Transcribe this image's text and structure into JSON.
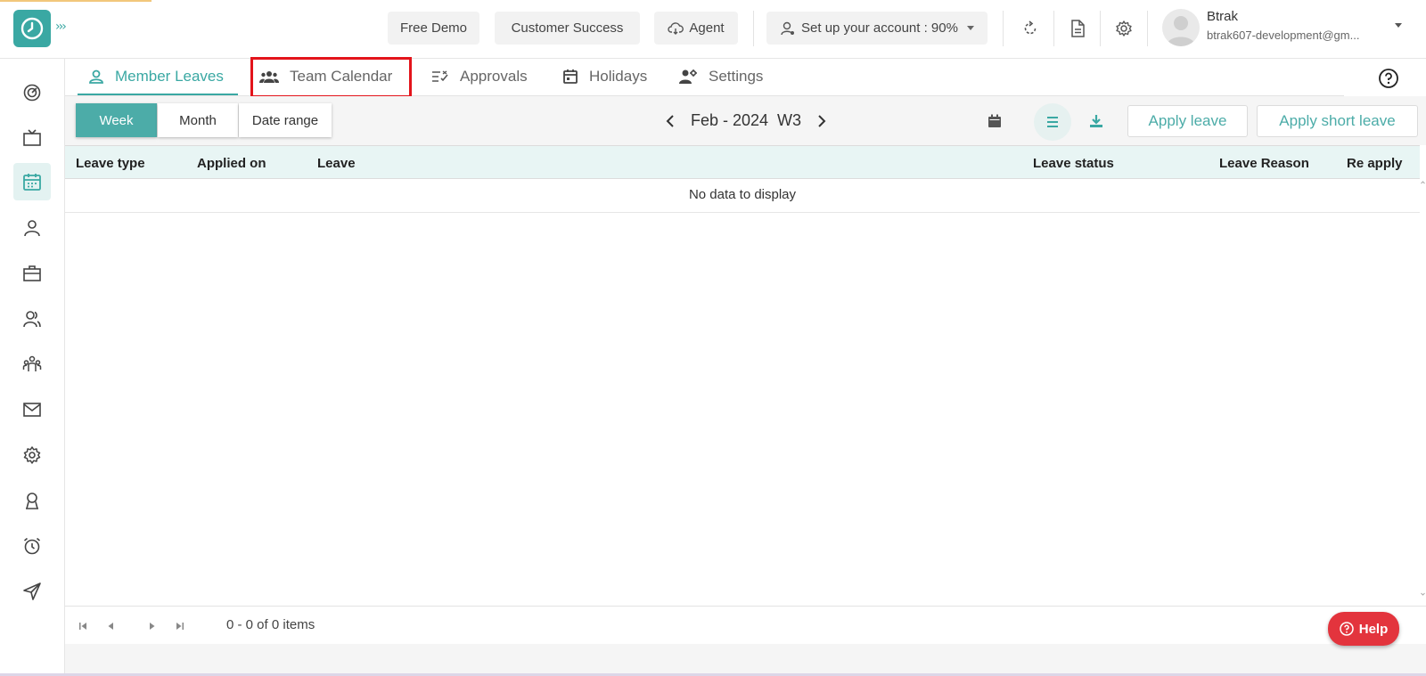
{
  "header": {
    "buttons": {
      "free_demo": "Free Demo",
      "customer_success": "Customer Success",
      "agent": "Agent",
      "setup": "Set up your account : 90%"
    },
    "user": {
      "name": "Btrak",
      "email": "btrak607-development@gm..."
    },
    "icons": [
      "app-logo-clock-icon",
      "expand-chevrons-icon",
      "cloud-icon",
      "user-setup-icon",
      "refresh-icon",
      "document-icon",
      "gear-icon"
    ]
  },
  "sidebar": {
    "icons": [
      "dashboard-icon",
      "tv-icon",
      "calendar-icon",
      "person-icon",
      "briefcase-icon",
      "users-icon",
      "team-icon",
      "mail-icon",
      "settings-icon",
      "badge-icon",
      "alarm-icon",
      "send-icon"
    ],
    "active": "calendar-icon"
  },
  "tabs": [
    {
      "label": "Member Leaves",
      "icon": "person-icon",
      "active": true
    },
    {
      "label": "Team Calendar",
      "icon": "team-icon",
      "active": false
    },
    {
      "label": "Approvals",
      "icon": "checklist-icon",
      "active": false
    },
    {
      "label": "Holidays",
      "icon": "calendar-icon",
      "active": false
    },
    {
      "label": "Settings",
      "icon": "user-settings-icon",
      "active": false
    }
  ],
  "toolbar": {
    "views": [
      "Week",
      "Month",
      "Date range"
    ],
    "active_view": "Week",
    "period": "Feb - 2024  W3",
    "apply_leave": "Apply leave",
    "apply_short_leave": "Apply short leave"
  },
  "table": {
    "columns": [
      "Leave type",
      "Applied on",
      "Leave",
      "Leave status",
      "Leave Reason",
      "Re apply"
    ],
    "empty_message": "No data to display"
  },
  "pager": {
    "info": "0 - 0 of 0 items"
  },
  "help": {
    "label": "Help"
  },
  "colors": {
    "accent": "#3aa8a3",
    "highlight": "#e3141b",
    "help": "#e3343d"
  }
}
